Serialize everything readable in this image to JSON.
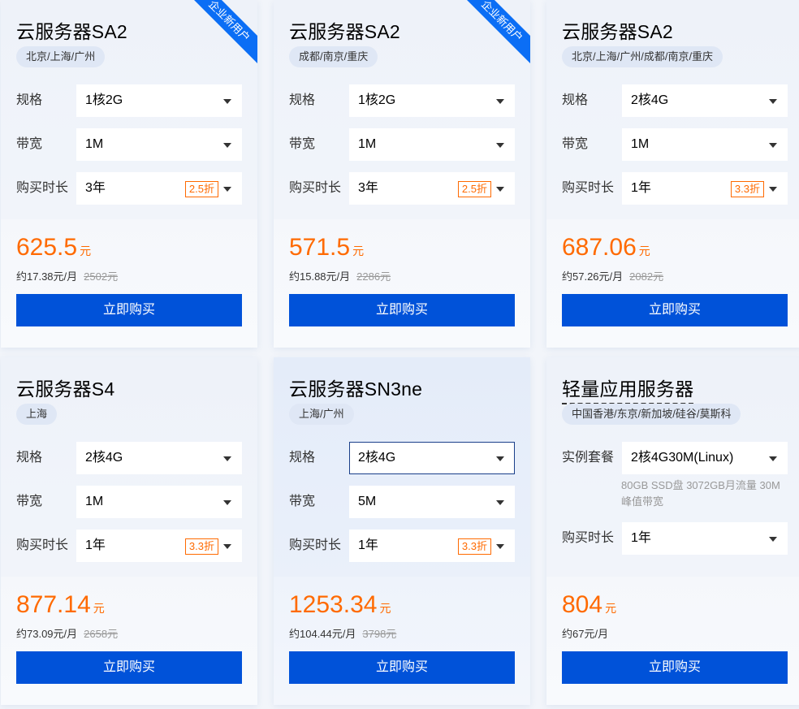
{
  "cards": [
    {
      "title": "云服务器SA2",
      "ribbon": "企业新用户",
      "region": "北京/上海/广州",
      "rows": [
        {
          "label": "规格",
          "value": "1核2G"
        },
        {
          "label": "带宽",
          "value": "1M"
        },
        {
          "label": "购买时长",
          "value": "3年",
          "discount": "2.5折"
        }
      ],
      "price": "625.5",
      "unit": "元",
      "monthly": "约17.38元/月",
      "original": "2502元",
      "buy": "立即购买"
    },
    {
      "title": "云服务器SA2",
      "ribbon": "企业新用户",
      "region": "成都/南京/重庆",
      "rows": [
        {
          "label": "规格",
          "value": "1核2G"
        },
        {
          "label": "带宽",
          "value": "1M"
        },
        {
          "label": "购买时长",
          "value": "3年",
          "discount": "2.5折"
        }
      ],
      "price": "571.5",
      "unit": "元",
      "monthly": "约15.88元/月",
      "original": "2286元",
      "buy": "立即购买"
    },
    {
      "title": "云服务器SA2",
      "region": "北京/上海/广州/成都/南京/重庆",
      "rows": [
        {
          "label": "规格",
          "value": "2核4G"
        },
        {
          "label": "带宽",
          "value": "1M"
        },
        {
          "label": "购买时长",
          "value": "1年",
          "discount": "3.3折"
        }
      ],
      "price": "687.06",
      "unit": "元",
      "monthly": "约57.26元/月",
      "original": "2082元",
      "buy": "立即购买"
    },
    {
      "title": "云服务器S4",
      "region": "上海",
      "rows": [
        {
          "label": "规格",
          "value": "2核4G"
        },
        {
          "label": "带宽",
          "value": "1M"
        },
        {
          "label": "购买时长",
          "value": "1年",
          "discount": "3.3折"
        }
      ],
      "price": "877.14",
      "unit": "元",
      "monthly": "约73.09元/月",
      "original": "2658元",
      "buy": "立即购买"
    },
    {
      "title": "云服务器SN3ne",
      "region": "上海/广州",
      "rows": [
        {
          "label": "规格",
          "value": "2核4G"
        },
        {
          "label": "带宽",
          "value": "5M"
        },
        {
          "label": "购买时长",
          "value": "1年",
          "discount": "3.3折"
        }
      ],
      "price": "1253.34",
      "unit": "元",
      "monthly": "约104.44元/月",
      "original": "3798元",
      "buy": "立即购买"
    },
    {
      "title": "轻量应用服务器",
      "region": "中国香港/东京/新加坡/硅谷/莫斯科",
      "rows": [
        {
          "label": "实例套餐",
          "value": "2核4G30M(Linux)"
        },
        {
          "label": "购买时长",
          "value": "1年"
        }
      ],
      "note_line1": "80GB SSD盘 3072GB月流量 30M",
      "note_line2": "峰值带宽",
      "price": "804",
      "unit": "元",
      "monthly": "约67元/月",
      "buy": "立即购买"
    }
  ]
}
